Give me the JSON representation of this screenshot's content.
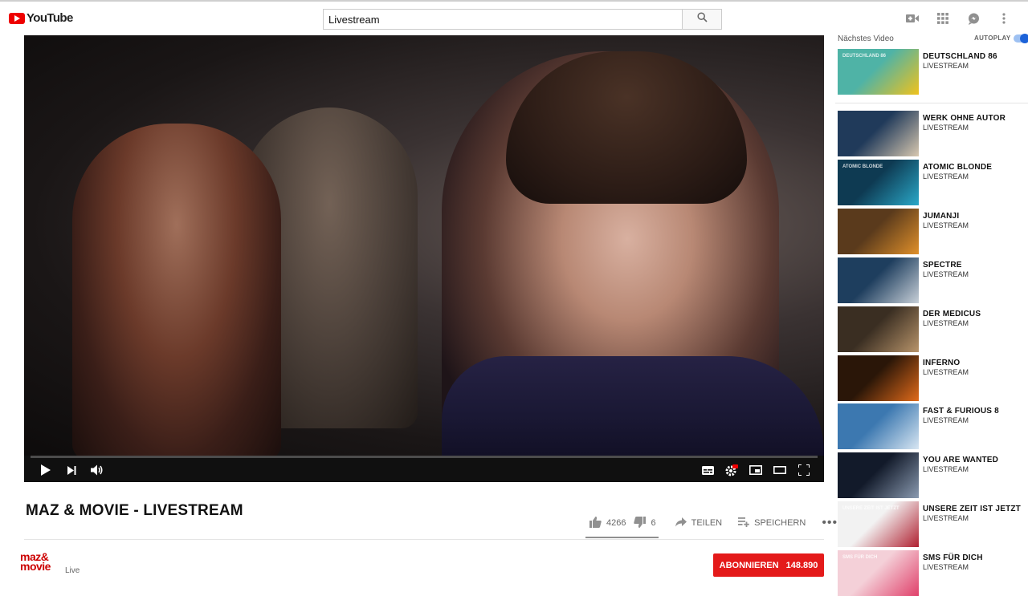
{
  "header": {
    "logo_text": "YouTube",
    "search_value": "Livestream"
  },
  "video": {
    "title": "MAZ & MOVIE - LIVESTREAM",
    "likes": "4266",
    "dislikes": "6",
    "like_ratio": 0.9986,
    "share_label": "TEILEN",
    "save_label": "SPEICHERN",
    "more_label": "•••"
  },
  "channel": {
    "logo_line1": "maz&",
    "logo_line2": "movie",
    "subtitle": "Live",
    "subscribe_label": "ABONNIEREN",
    "subscriber_count": "148.890"
  },
  "sidebar": {
    "next_label": "Nächstes Video",
    "autoplay_label": "AUTOPLAY",
    "autoplay_on": true,
    "items": [
      {
        "title": "DEUTSCHLAND 86",
        "channel": "LIVESTREAM",
        "thumb_bg": "#4fb3a6",
        "thumb_accent": "#f0c21c",
        "thumb_text": "DEUTSCHLAND 86"
      },
      {
        "title": "WERK OHNE AUTOR",
        "channel": "LIVESTREAM",
        "thumb_bg": "#203a5a",
        "thumb_accent": "#d8c8b0",
        "thumb_text": ""
      },
      {
        "title": "ATOMIC BLONDE",
        "channel": "LIVESTREAM",
        "thumb_bg": "#0e3a52",
        "thumb_accent": "#2aa8c8",
        "thumb_text": "ATOMIC BLONDE"
      },
      {
        "title": "JUMANJI",
        "channel": "LIVESTREAM",
        "thumb_bg": "#5a3a1c",
        "thumb_accent": "#e0902a",
        "thumb_text": ""
      },
      {
        "title": "SPECTRE",
        "channel": "LIVESTREAM",
        "thumb_bg": "#1e3e5e",
        "thumb_accent": "#c8d0d8",
        "thumb_text": ""
      },
      {
        "title": "DER MEDICUS",
        "channel": "LIVESTREAM",
        "thumb_bg": "#3a2e22",
        "thumb_accent": "#b8946a",
        "thumb_text": ""
      },
      {
        "title": "INFERNO",
        "channel": "LIVESTREAM",
        "thumb_bg": "#2a1608",
        "thumb_accent": "#e06a1a",
        "thumb_text": ""
      },
      {
        "title": "FAST & FURIOUS 8",
        "channel": "LIVESTREAM",
        "thumb_bg": "#3c78b0",
        "thumb_accent": "#d8e6f2",
        "thumb_text": ""
      },
      {
        "title": "YOU ARE WANTED",
        "channel": "LIVESTREAM",
        "thumb_bg": "#121a2a",
        "thumb_accent": "#8a9ab0",
        "thumb_text": ""
      },
      {
        "title": "UNSERE ZEIT IST JETZT",
        "channel": "LIVESTREAM",
        "thumb_bg": "#f2f2f2",
        "thumb_accent": "#b02030",
        "thumb_text": "UNSERE ZEIT IST JETZT"
      },
      {
        "title": "SMS FÜR DICH",
        "channel": "LIVESTREAM",
        "thumb_bg": "#f4d0d8",
        "thumb_accent": "#e0406a",
        "thumb_text": "SMS FÜR DICH"
      }
    ]
  },
  "colors": {
    "brand_red": "#e00000",
    "subscribe_red": "#e41a1a",
    "autoplay_blue": "#1c62d8"
  },
  "icons": [
    "youtube-logo-icon",
    "search-icon",
    "video-camera-icon",
    "apps-grid-icon",
    "messages-icon",
    "more-vert-icon",
    "play-icon",
    "next-icon",
    "volume-icon",
    "subtitles-icon",
    "settings-icon",
    "miniplayer-icon",
    "theater-icon",
    "fullscreen-icon",
    "thumb-up-icon",
    "thumb-down-icon",
    "share-icon",
    "playlist-add-icon"
  ]
}
